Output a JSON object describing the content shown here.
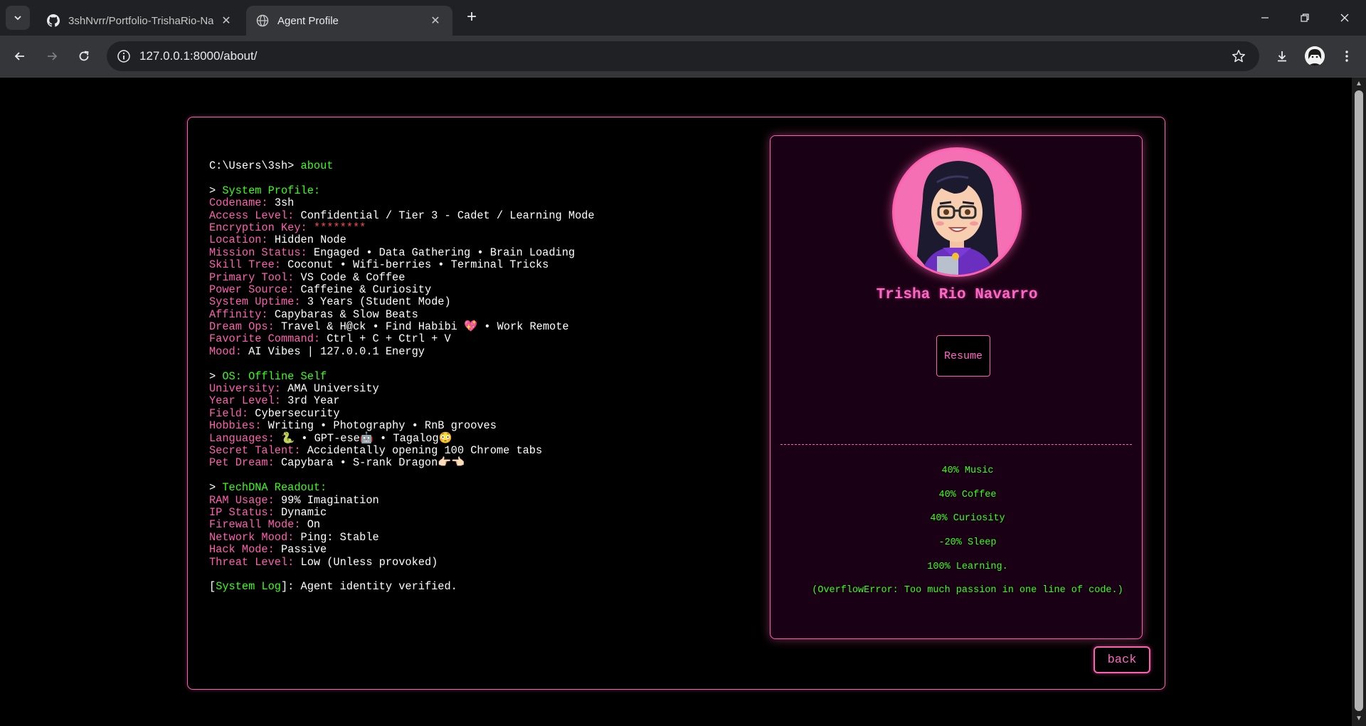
{
  "browser": {
    "tabs": [
      {
        "title": "3shNvrr/Portfolio-TrishaRio-Navarro",
        "favicon": "github-icon",
        "active": false
      },
      {
        "title": "Agent Profile",
        "favicon": "globe-icon",
        "active": true
      }
    ],
    "url": "127.0.0.1:8000/about/"
  },
  "console": {
    "prompt": "C:\\Users\\3sh>",
    "command": "about",
    "sections": [
      {
        "heading": "System Profile:",
        "rows": [
          {
            "key": "Codename:",
            "value": "3sh"
          },
          {
            "key": "Access Level:",
            "value": "Confidential / Tier 3 - Cadet / Learning Mode"
          },
          {
            "key": "Encryption Key:",
            "value": "********"
          },
          {
            "key": "Location:",
            "value": "Hidden Node"
          },
          {
            "key": "Mission Status:",
            "value": "Engaged • Data Gathering • Brain Loading"
          },
          {
            "key": "Skill Tree:",
            "value": "Coconut • Wifi-berries • Terminal Tricks"
          },
          {
            "key": "Primary Tool:",
            "value": "VS Code & Coffee"
          },
          {
            "key": "Power Source:",
            "value": "Caffeine & Curiosity"
          },
          {
            "key": "System Uptime:",
            "value": "3 Years (Student Mode)"
          },
          {
            "key": "Affinity:",
            "value": "Capybaras & Slow Beats"
          },
          {
            "key": "Dream Ops:",
            "value": "Travel & H@ck • Find Habibi 💖 • Work Remote"
          },
          {
            "key": "Favorite Command:",
            "value": "Ctrl + C + Ctrl + V"
          },
          {
            "key": "Mood:",
            "value": "AI Vibes | 127.0.0.1 Energy"
          }
        ]
      },
      {
        "heading": "OS: Offline Self",
        "rows": [
          {
            "key": "University:",
            "value": "AMA University"
          },
          {
            "key": "Year Level:",
            "value": "3rd Year"
          },
          {
            "key": "Field:",
            "value": "Cybersecurity"
          },
          {
            "key": "Hobbies:",
            "value": "Writing • Photography • RnB grooves"
          },
          {
            "key": "Languages:",
            "value": "🐍 • GPT-ese🤖 • Tagalog😳"
          },
          {
            "key": "Secret Talent:",
            "value": "Accidentally opening 100 Chrome tabs"
          },
          {
            "key": "Pet Dream:",
            "value": "Capybara • S-rank Dragon👉🏻👈🏻"
          }
        ]
      },
      {
        "heading": "TechDNA Readout:",
        "rows": [
          {
            "key": "RAM Usage:",
            "value": "99% Imagination"
          },
          {
            "key": "IP Status:",
            "value": "Dynamic"
          },
          {
            "key": "Firewall Mode:",
            "value": "On"
          },
          {
            "key": "Network Mood:",
            "value": "Ping: Stable"
          },
          {
            "key": "Hack Mode:",
            "value": "Passive"
          },
          {
            "key": "Threat Level:",
            "value": "Low (Unless provoked)"
          }
        ]
      }
    ],
    "log_label": "System Log",
    "log_message": ": Agent identity verified."
  },
  "profile": {
    "name": "Trisha Rio Navarro",
    "resume_label": "Resume",
    "stats": [
      "40% Music",
      "40% Coffee",
      "40% Curiosity",
      "-20% Sleep",
      "100% Learning.",
      "(OverflowError: Too much passion in one line of code.)"
    ]
  },
  "back_label": "back",
  "colors": {
    "accent_pink": "#ff5fb0",
    "terminal_green": "#39ff14",
    "secret_red": "#ff4d4d",
    "card_bg": "#1a0014"
  }
}
